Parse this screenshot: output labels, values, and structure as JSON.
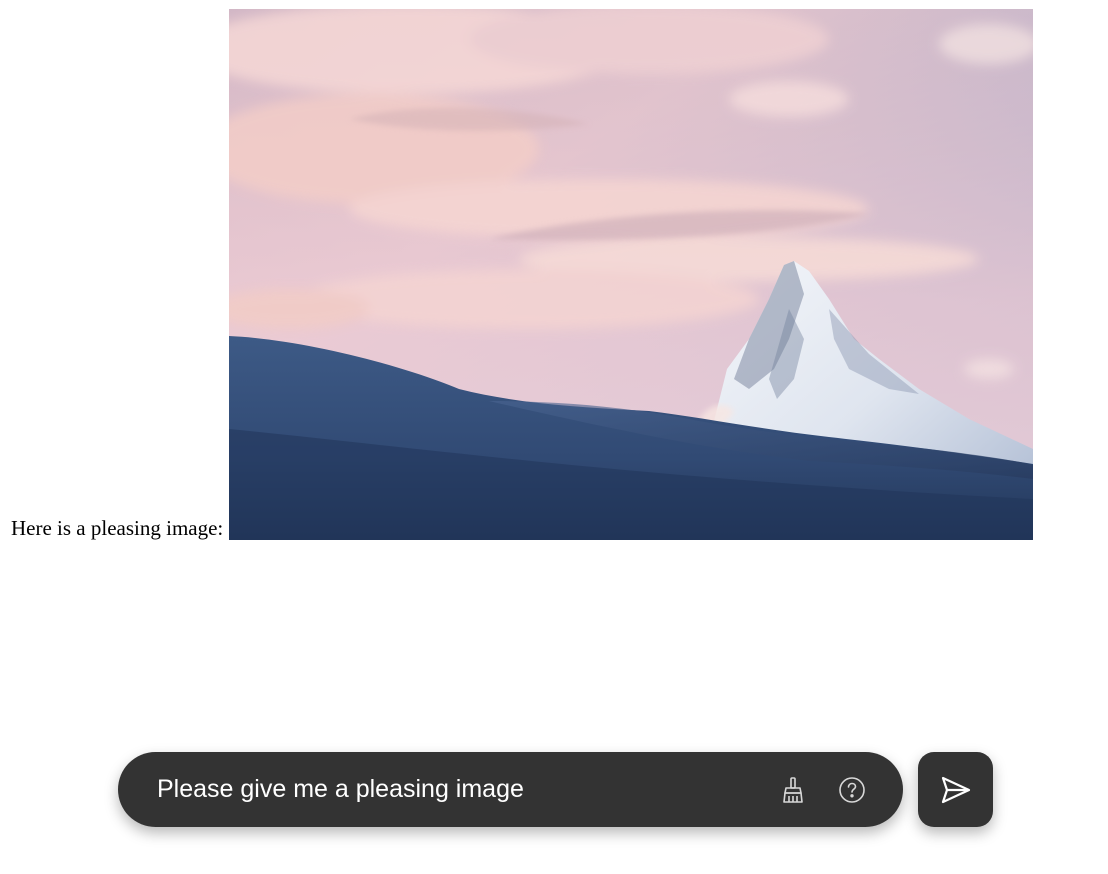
{
  "response": {
    "text": "Here is a pleasing image:",
    "image": {
      "icon": "mountain-landscape-photo",
      "sky_top": "#a7a3c4",
      "sky_bottom": "#eccbd0",
      "snow_color": "#3c5580"
    }
  },
  "prompt_bar": {
    "value": "Please give me a pleasing image",
    "background": "#333333",
    "clear_icon": "broom-icon",
    "help_icon": "help-circle-icon"
  },
  "send_button": {
    "icon": "send-icon"
  }
}
